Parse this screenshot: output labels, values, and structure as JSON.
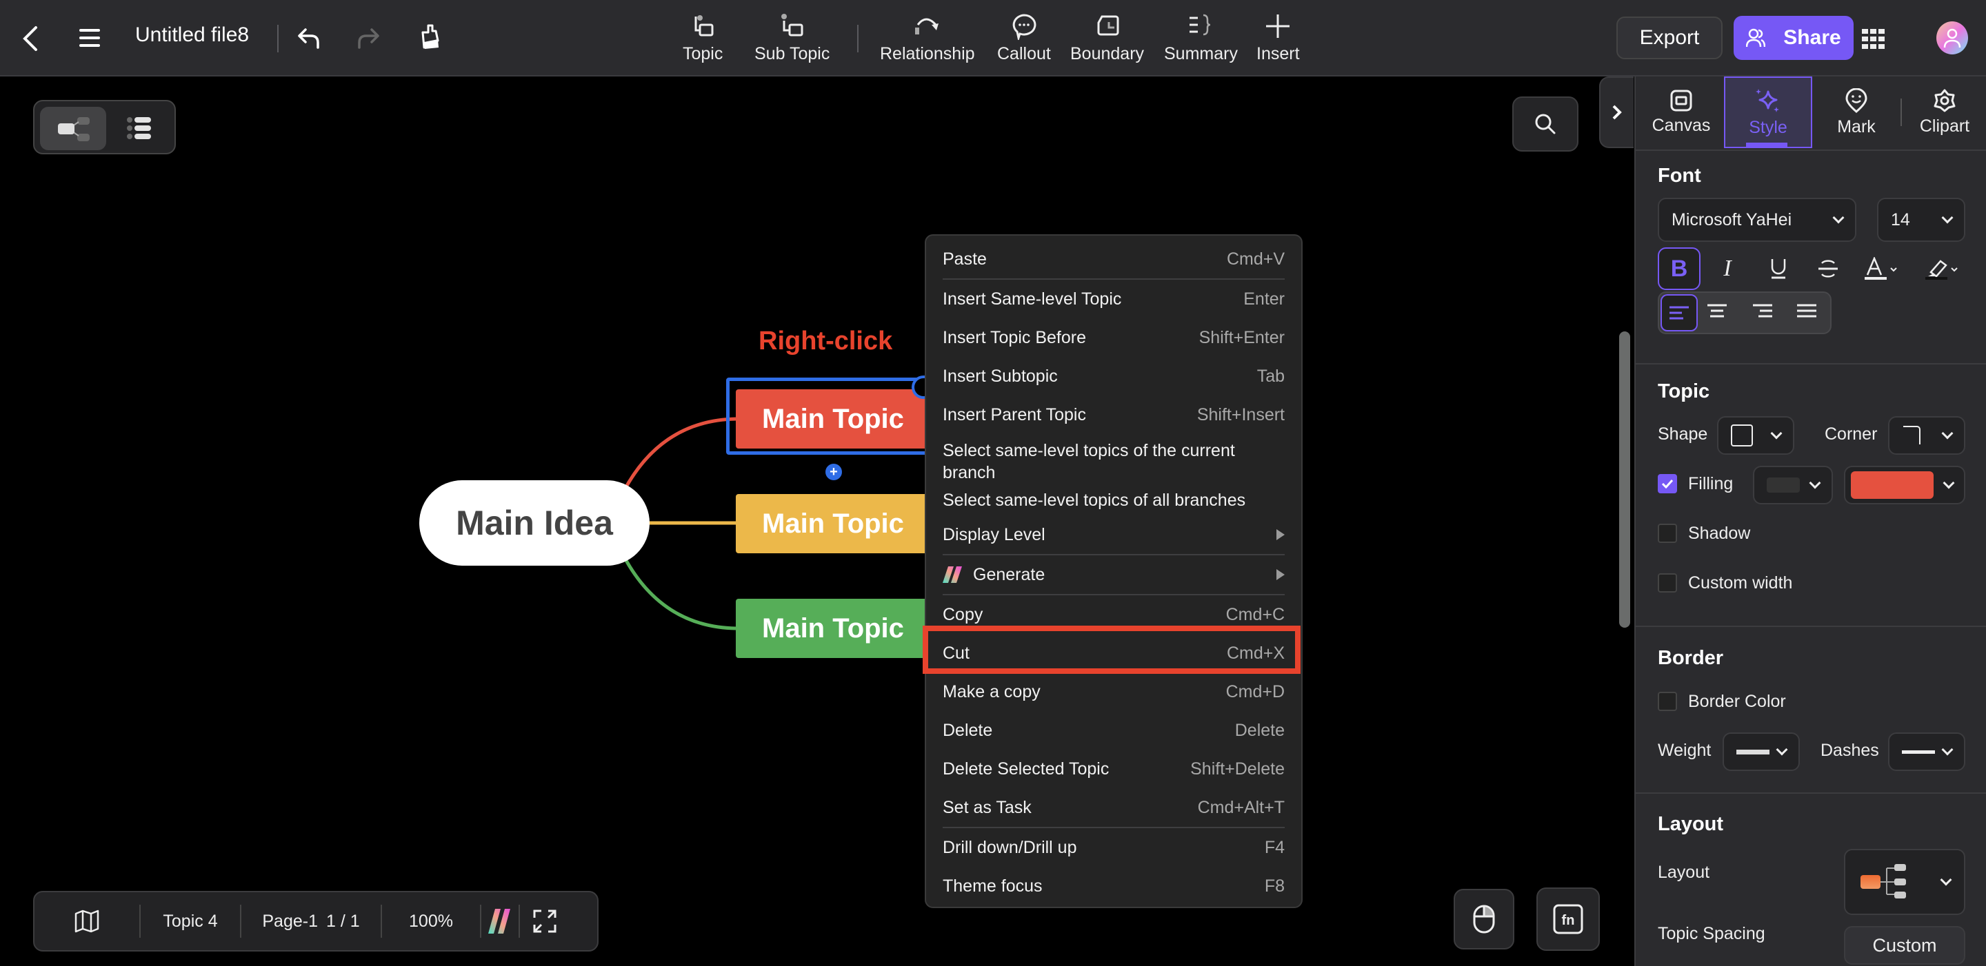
{
  "topbar": {
    "file_title": "Untitled file8",
    "tools": [
      {
        "label": "Topic",
        "icon": "topic-icon"
      },
      {
        "label": "Sub Topic",
        "icon": "subtopic-icon"
      },
      {
        "label": "Relationship",
        "icon": "relationship-icon"
      },
      {
        "label": "Callout",
        "icon": "callout-icon"
      },
      {
        "label": "Boundary",
        "icon": "boundary-icon"
      },
      {
        "label": "Summary",
        "icon": "summary-icon"
      },
      {
        "label": "Insert",
        "icon": "plus-icon"
      }
    ],
    "export_label": "Export",
    "share_label": "Share",
    "accent_color": "#7658f5"
  },
  "canvas": {
    "annotation": "Right-click",
    "annotation_color": "#e8432d",
    "central_topic": "Main Idea",
    "topics": [
      {
        "label": "Main Topic",
        "color": "#e5513f",
        "selected": true
      },
      {
        "label": "Main Topic",
        "color": "#ecb84a",
        "selected": false
      },
      {
        "label": "Main Topic",
        "color": "#56ae58",
        "selected": false
      }
    ],
    "selection_color": "#2f6de6"
  },
  "context_menu": {
    "items": [
      {
        "label": "Paste",
        "shortcut": "Cmd+V"
      },
      {
        "label": "Insert Same-level Topic",
        "shortcut": "Enter"
      },
      {
        "label": "Insert Topic Before",
        "shortcut": "Shift+Enter"
      },
      {
        "label": "Insert Subtopic",
        "shortcut": "Tab"
      },
      {
        "label": "Insert Parent Topic",
        "shortcut": "Shift+Insert"
      },
      {
        "label": "Select same-level topics of the current branch",
        "shortcut": ""
      },
      {
        "label": "Select same-level topics of all branches",
        "shortcut": ""
      },
      {
        "label": "Display Level",
        "shortcut": "",
        "submenu": true
      },
      {
        "label": "Generate",
        "shortcut": "",
        "submenu": true
      },
      {
        "label": "Copy",
        "shortcut": "Cmd+C"
      },
      {
        "label": "Cut",
        "shortcut": "Cmd+X",
        "highlighted": true
      },
      {
        "label": "Make a copy",
        "shortcut": "Cmd+D"
      },
      {
        "label": "Delete",
        "shortcut": "Delete"
      },
      {
        "label": "Delete Selected Topic",
        "shortcut": "Shift+Delete"
      },
      {
        "label": "Set as Task",
        "shortcut": "Cmd+Alt+T"
      },
      {
        "label": "Drill down/Drill up",
        "shortcut": "F4"
      },
      {
        "label": "Theme focus",
        "shortcut": "F8"
      }
    ],
    "highlight_color": "#e8432d"
  },
  "bottom_bar": {
    "topic_count": "Topic 4",
    "page_name": "Page-1",
    "page_index": "1 / 1",
    "zoom": "100%"
  },
  "right_panel": {
    "tabs": [
      {
        "label": "Canvas",
        "active": false
      },
      {
        "label": "Style",
        "active": true
      },
      {
        "label": "Mark",
        "active": false
      },
      {
        "label": "Clipart",
        "active": false
      }
    ],
    "font": {
      "title": "Font",
      "family": "Microsoft YaHei",
      "size": "14",
      "bold": true,
      "align": "left"
    },
    "topic": {
      "title": "Topic",
      "shape_label": "Shape",
      "corner_label": "Corner",
      "filling_label": "Filling",
      "filling_checked": true,
      "fill_color": "#e5513f",
      "shadow_label": "Shadow",
      "shadow_checked": false,
      "custom_width_label": "Custom width",
      "custom_width_checked": false
    },
    "border": {
      "title": "Border",
      "color_label": "Border Color",
      "color_checked": false,
      "weight_label": "Weight",
      "dashes_label": "Dashes"
    },
    "layout": {
      "title": "Layout",
      "layout_label": "Layout",
      "spacing_label": "Topic Spacing",
      "spacing_value": "Custom"
    }
  }
}
